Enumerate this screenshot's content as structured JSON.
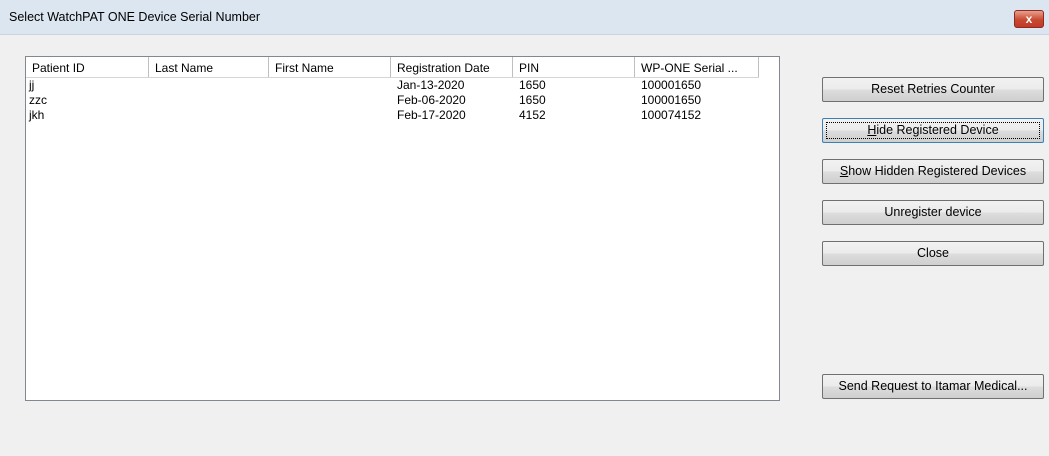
{
  "window": {
    "title": "Select WatchPAT ONE Device Serial Number",
    "close_symbol": "x"
  },
  "table": {
    "columns": [
      "Patient ID",
      "Last Name",
      "First Name",
      "Registration Date",
      "PIN",
      "WP-ONE Serial ..."
    ],
    "rows": [
      {
        "patient_id": "jj",
        "last_name": "",
        "first_name": "",
        "registration_date": "Jan-13-2020",
        "pin": "1650",
        "serial": "100001650"
      },
      {
        "patient_id": "zzc",
        "last_name": "",
        "first_name": "",
        "registration_date": "Feb-06-2020",
        "pin": "1650",
        "serial": "100001650"
      },
      {
        "patient_id": "jkh",
        "last_name": "",
        "first_name": "",
        "registration_date": "Feb-17-2020",
        "pin": "4152",
        "serial": "100074152"
      }
    ]
  },
  "buttons": {
    "reset": "Reset Retries Counter",
    "hide_first": "H",
    "hide_rest": "ide Registered Device",
    "show_first": "S",
    "show_rest": "how Hidden Registered Devices",
    "unregister": "Unregister device",
    "close": "Close",
    "send": "Send Request to Itamar Medical..."
  }
}
